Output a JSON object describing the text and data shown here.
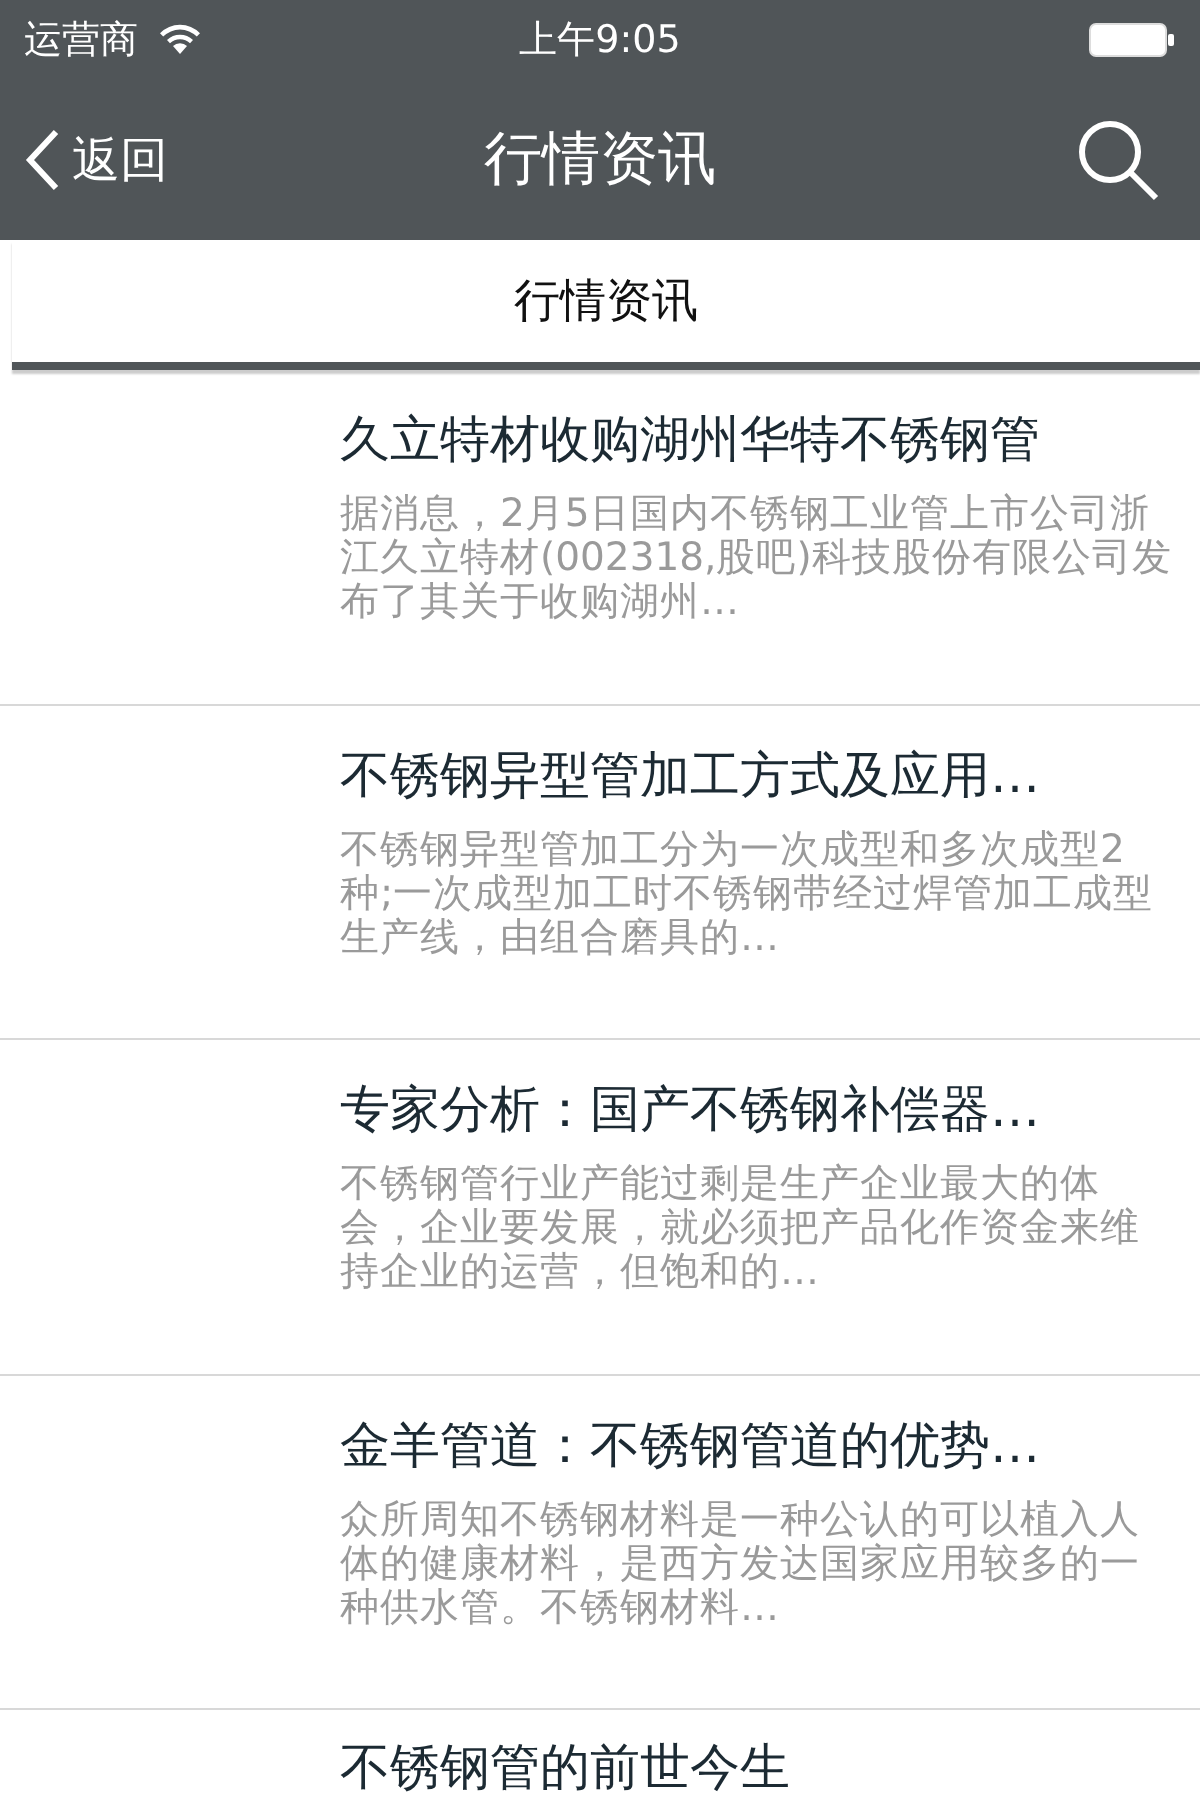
{
  "status_bar": {
    "carrier": "运营商",
    "time": "上午9:05"
  },
  "nav_bar": {
    "back": "返回",
    "title": "行情资讯"
  },
  "tabs": [
    {
      "label": "行情资讯",
      "selected": true
    }
  ],
  "articles": [
    {
      "title": "久立特材收购湖州华特不锈钢管",
      "summary": "据消息，2月5日国内不锈钢工业管上市公司浙江久立特材(002318,股吧)科技股份有限公司发布了其关于收购湖州…"
    },
    {
      "title": "不锈钢异型管加工方式及应用…",
      "summary": "不锈钢异型管加工分为一次成型和多次成型2种;一次成型加工时不锈钢带经过焊管加工成型生产线，由组合磨具的…"
    },
    {
      "title": "专家分析：国产不锈钢补偿器…",
      "summary": "不锈钢管行业产能过剩是生产企业最大的体会，企业要发展，就必须把产品化作资金来维持企业的运营，但饱和的…"
    },
    {
      "title": "金羊管道：不锈钢管道的优势…",
      "summary": "众所周知不锈钢材料是一种公认的可以植入人体的健康材料，是西方发达国家应用较多的一种供水管。不锈钢材料…"
    },
    {
      "title": "不锈钢管的前世今生"
    }
  ]
}
